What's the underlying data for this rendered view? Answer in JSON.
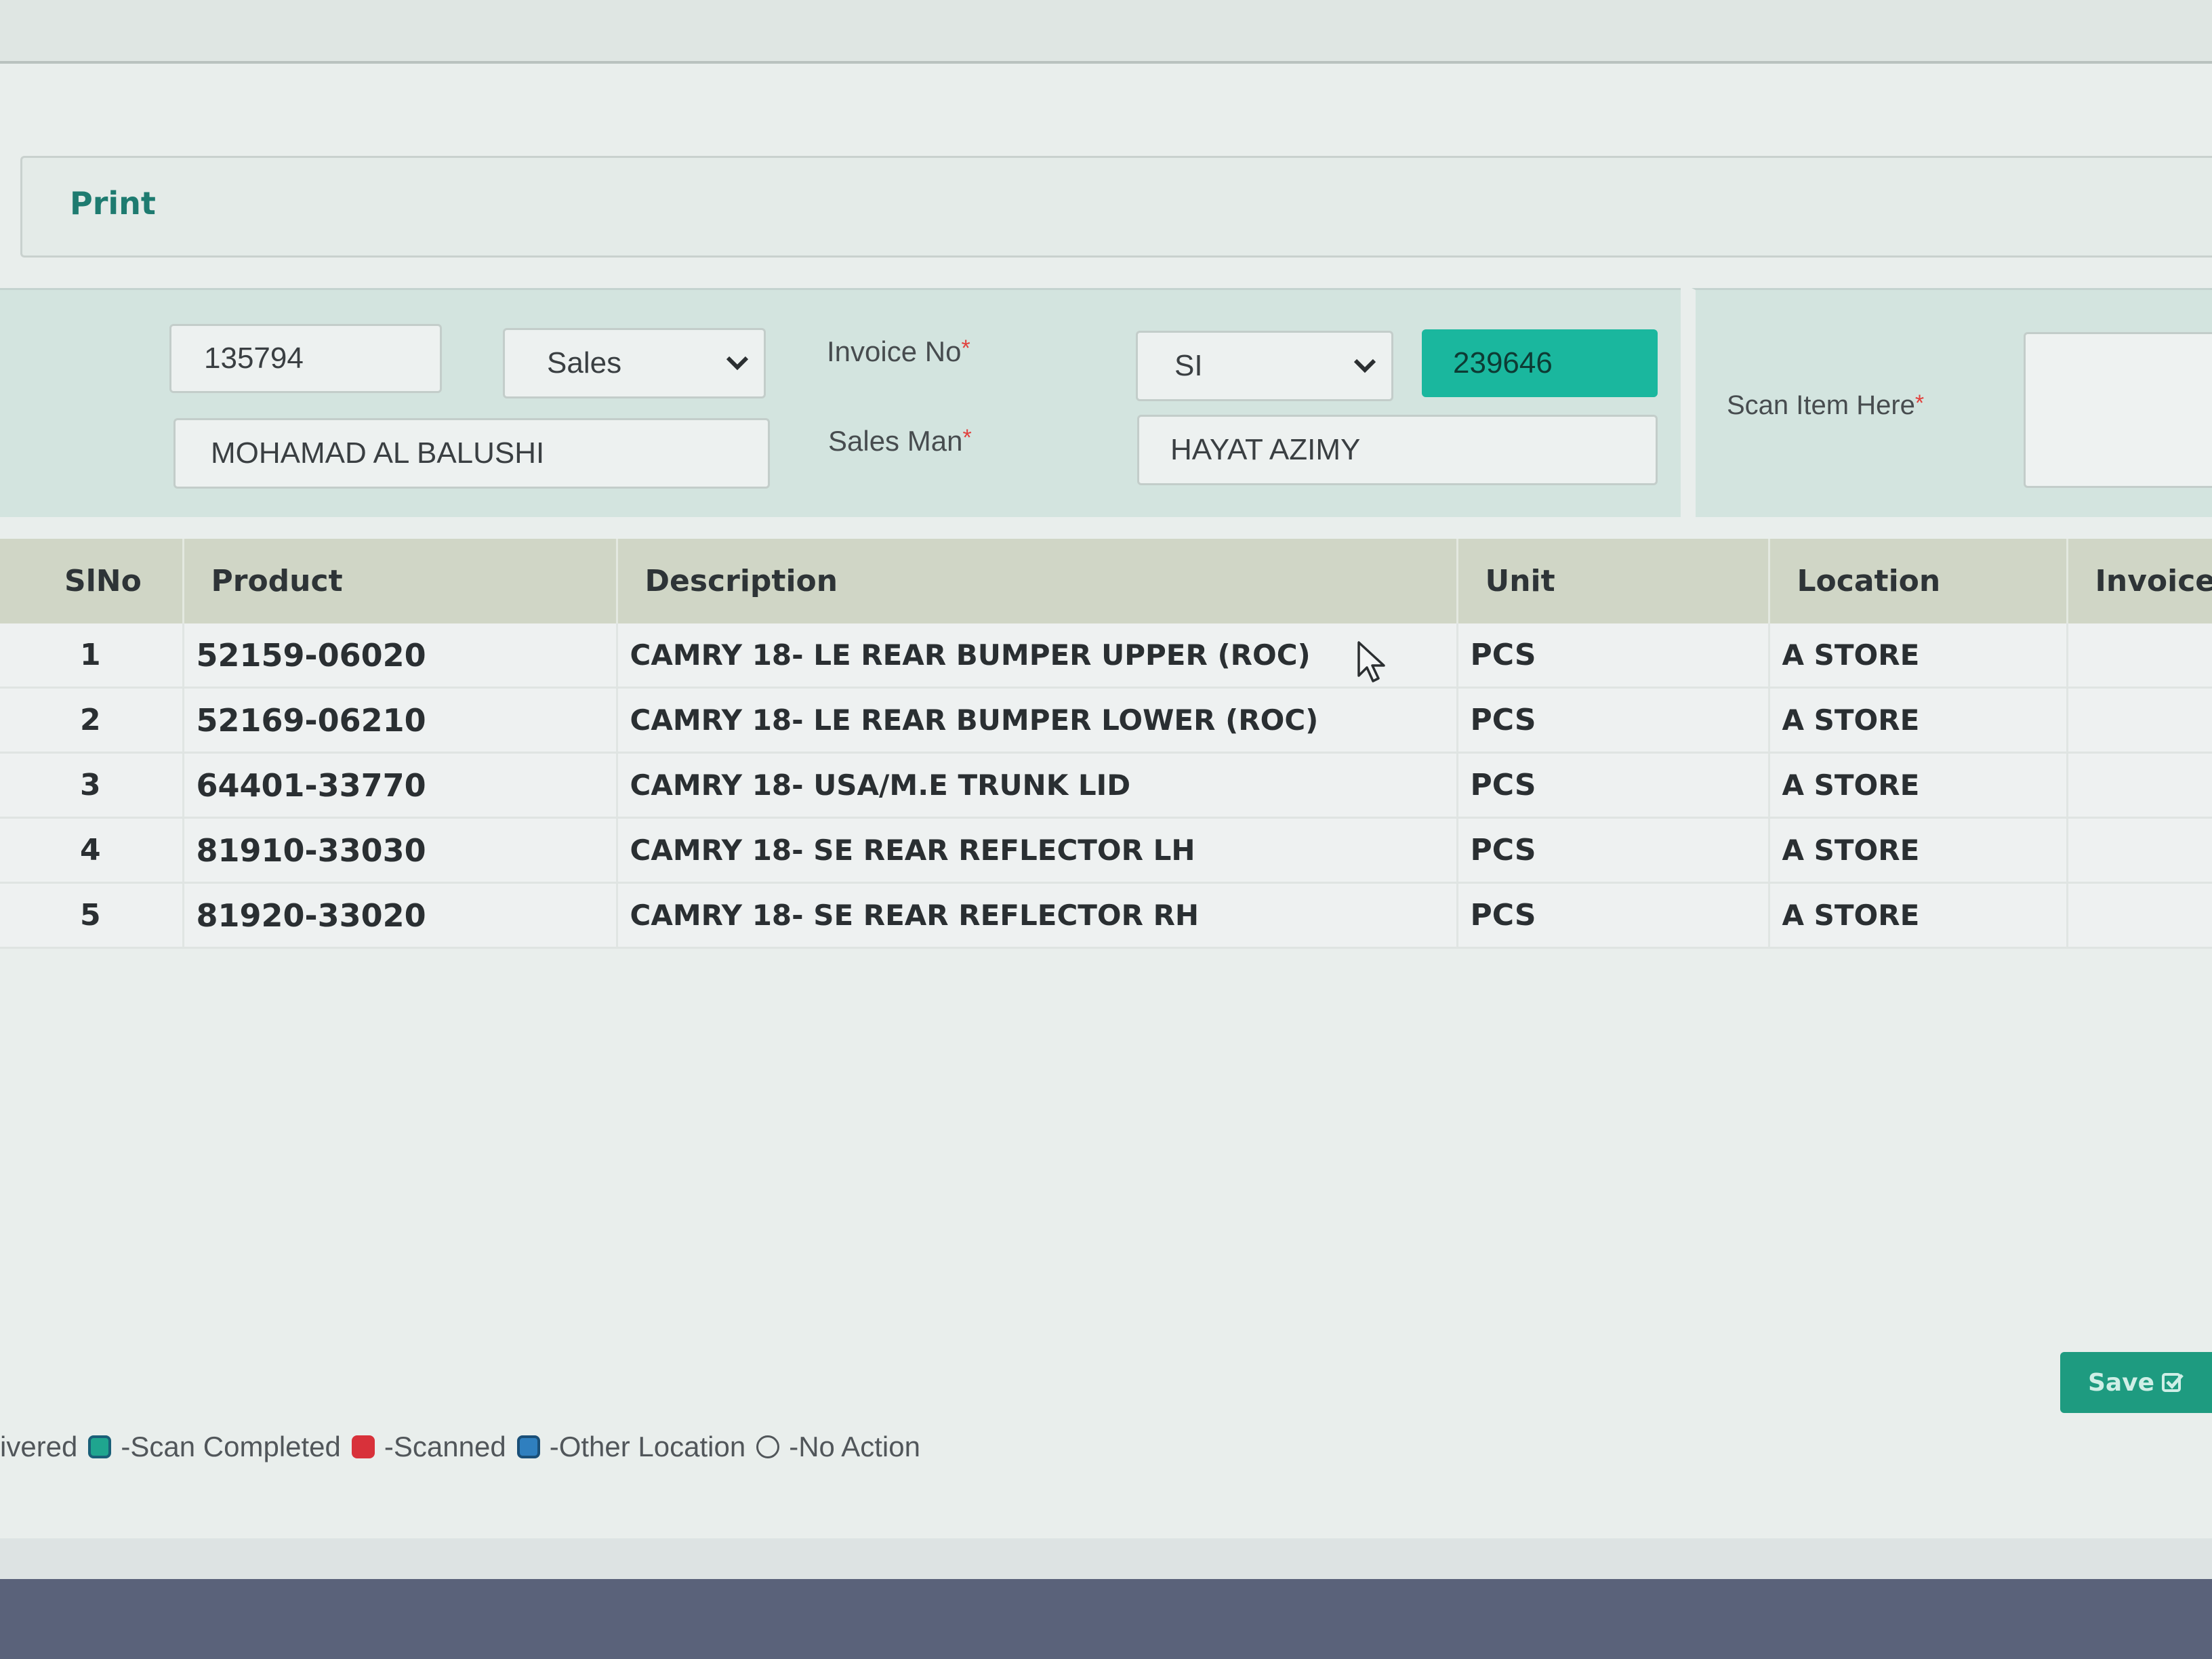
{
  "toolbar": {
    "print_label": "Print"
  },
  "form": {
    "customer_code": "135794",
    "type_select": {
      "value": "Sales"
    },
    "customer_name": "MOHAMAD AL BALUSHI",
    "invoice_no_label": "Invoice No",
    "invoice_prefix_select": {
      "value": "SI"
    },
    "invoice_number": "239646",
    "salesman_label": "Sales Man",
    "salesman_value": "HAYAT AZIMY",
    "scan_label": "Scan Item Here",
    "required_mark": "*"
  },
  "table": {
    "headers": [
      "SlNo",
      "Product",
      "Description",
      "Unit",
      "Location",
      "Invoice Q"
    ],
    "rows": [
      [
        "1",
        "52159-06020",
        "CAMRY 18- LE REAR BUMPER UPPER (ROC)",
        "PCS",
        "A STORE",
        ""
      ],
      [
        "2",
        "52169-06210",
        "CAMRY 18- LE REAR BUMPER LOWER (ROC)",
        "PCS",
        "A STORE",
        ""
      ],
      [
        "3",
        "64401-33770",
        "CAMRY 18- USA/M.E TRUNK LID",
        "PCS",
        "A STORE",
        ""
      ],
      [
        "4",
        "81910-33030",
        "CAMRY 18- SE REAR REFLECTOR LH",
        "PCS",
        "A STORE",
        ""
      ],
      [
        "5",
        "81920-33020",
        "CAMRY 18- SE REAR REFLECTOR RH",
        "PCS",
        "A STORE",
        ""
      ]
    ]
  },
  "actions": {
    "save_label": "Save"
  },
  "legend": {
    "items": [
      {
        "label": "ivered",
        "swatch": null
      },
      {
        "label": "-Scan Completed",
        "swatch": "#1fa58f"
      },
      {
        "label": "-Scanned",
        "swatch": "#d8313a"
      },
      {
        "label": "-Other Location",
        "swatch": "#2f7fbf"
      },
      {
        "label": "-No Action",
        "swatch": "outline"
      }
    ]
  },
  "colors": {
    "accent": "#1ab79e",
    "save_button": "#1e9b80",
    "header_bg": "#d0d6c6",
    "form_bg": "#d3e4df"
  }
}
